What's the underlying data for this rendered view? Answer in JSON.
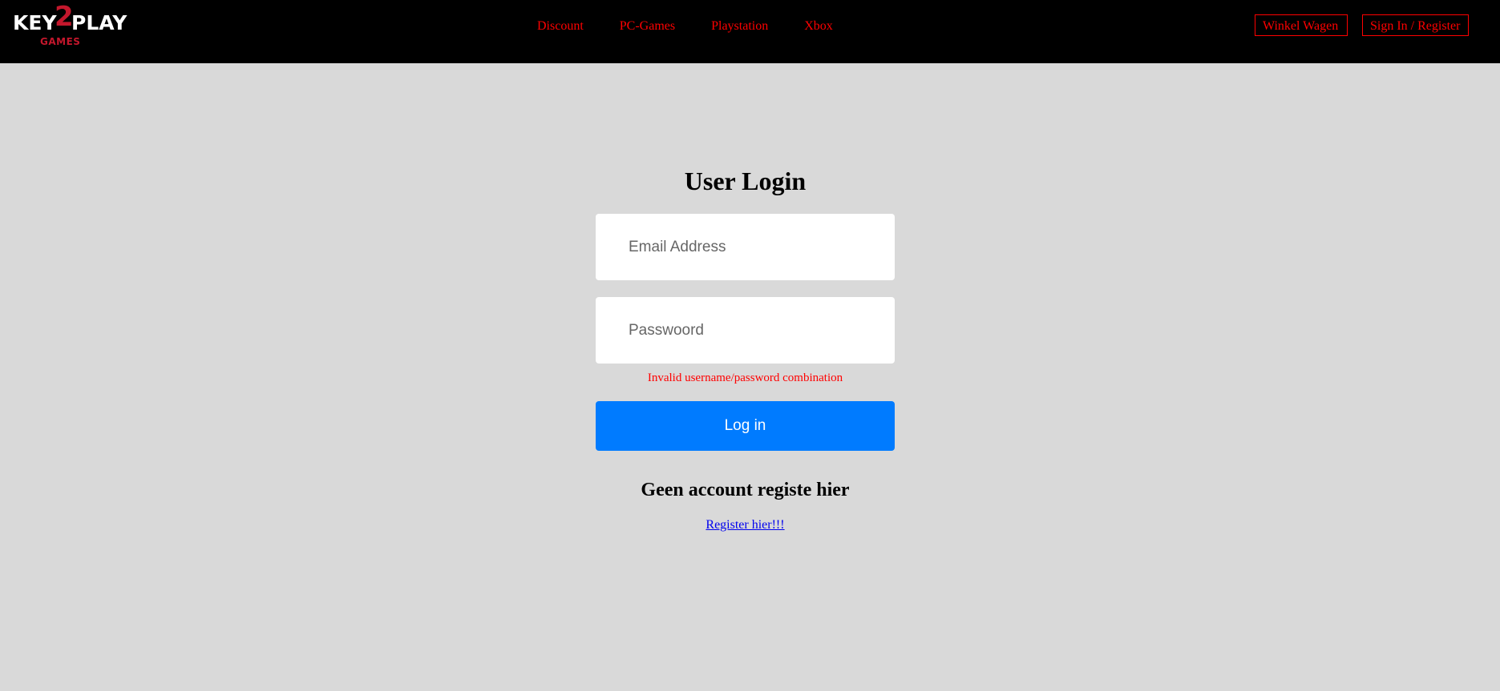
{
  "header": {
    "logo": {
      "key": "KEY",
      "two": "2",
      "play": "PLAY",
      "games": "GAMES"
    },
    "nav": [
      {
        "label": "Discount"
      },
      {
        "label": "PC-Games"
      },
      {
        "label": "Playstation"
      },
      {
        "label": "Xbox"
      }
    ],
    "cart_label": "Winkel Wagen",
    "signin_label": "Sign In / Register"
  },
  "login": {
    "title": "User Login",
    "email_placeholder": "Email Address",
    "password_placeholder": "Passwoord",
    "error": "Invalid username/password combination",
    "button_label": "Log in",
    "no_account": "Geen account registe hier",
    "register_link": "Register hier!!!"
  },
  "colors": {
    "navbar_bg": "#000000",
    "accent_red": "#ff0000",
    "logo_red": "#c3172c",
    "page_bg": "#d9d9d9",
    "button_blue": "#007bff",
    "link_blue": "#0000ee"
  }
}
